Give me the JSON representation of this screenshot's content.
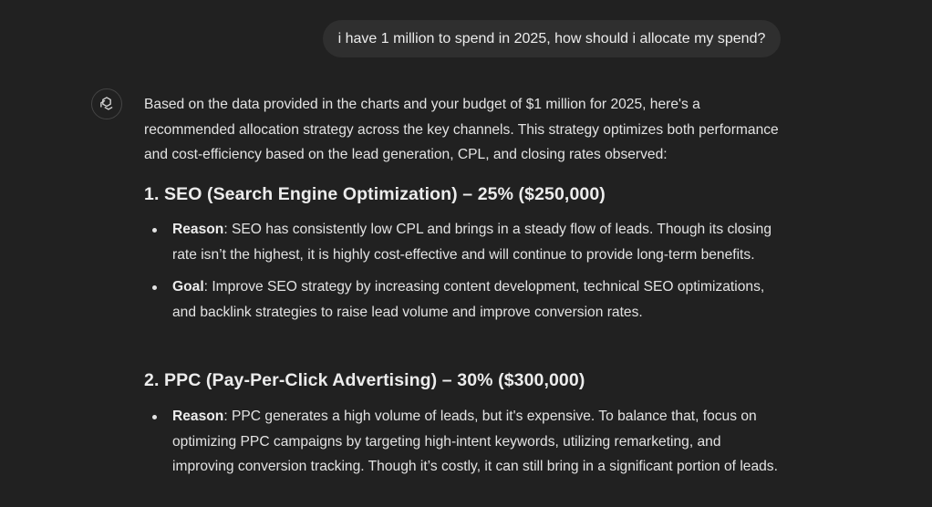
{
  "user_message": "i have 1 million to spend in 2025, how should i allocate my spend?",
  "assistant": {
    "avatar_icon": "openai-logo-icon",
    "intro": "Based on the data provided in the charts and your budget of $1 million for 2025, here's a recommended allocation strategy across the key channels. This strategy optimizes both performance and cost-efficiency based on the lead generation, CPL, and closing rates observed:",
    "sections": [
      {
        "heading": "1. SEO (Search Engine Optimization) – 25% ($250,000)",
        "items": [
          {
            "label": "Reason",
            "text": ": SEO has consistently low CPL and brings in a steady flow of leads. Though its closing rate isn’t the highest, it is highly cost-effective and will continue to provide long-term benefits."
          },
          {
            "label": "Goal",
            "text": ": Improve SEO strategy by increasing content development, technical SEO optimizations, and backlink strategies to raise lead volume and improve conversion rates."
          }
        ]
      },
      {
        "heading": "2. PPC (Pay-Per-Click Advertising) – 30% ($300,000)",
        "items": [
          {
            "label": "Reason",
            "text": ": PPC generates a high volume of leads, but it's expensive. To balance that, focus on optimizing PPC campaigns by targeting high-intent keywords, utilizing remarketing, and improving conversion tracking. Though it’s costly, it can still bring in a significant portion of leads."
          }
        ]
      }
    ]
  },
  "colors": {
    "background": "#212121",
    "user_bubble": "#2f2f2f",
    "text": "#e3e3e3"
  }
}
